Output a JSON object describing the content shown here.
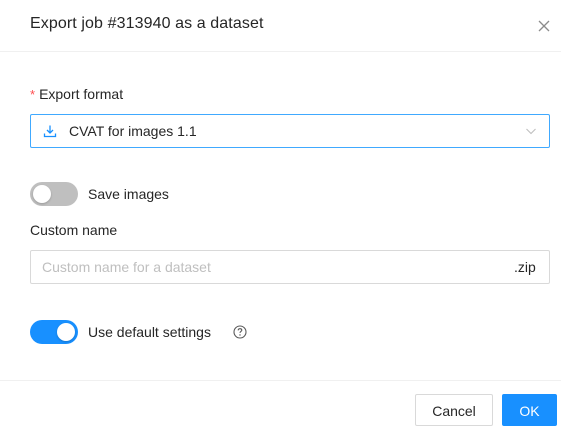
{
  "dialog": {
    "title": "Export job #313940 as a dataset"
  },
  "form": {
    "export_format": {
      "required_mark": "*",
      "label": "Export format",
      "value": "CVAT for images 1.1",
      "icon": "download-icon"
    },
    "save_images": {
      "label": "Save images",
      "enabled": false
    },
    "custom_name": {
      "label": "Custom name",
      "placeholder": "Custom name for a dataset",
      "value": "",
      "suffix": ".zip"
    },
    "use_default_settings": {
      "label": "Use default settings",
      "enabled": true,
      "help_icon": "question-circle-icon"
    }
  },
  "footer": {
    "cancel_label": "Cancel",
    "ok_label": "OK"
  },
  "colors": {
    "primary": "#1890ff",
    "required": "#ff4d4f",
    "toggle_off": "#bfbfbf"
  }
}
